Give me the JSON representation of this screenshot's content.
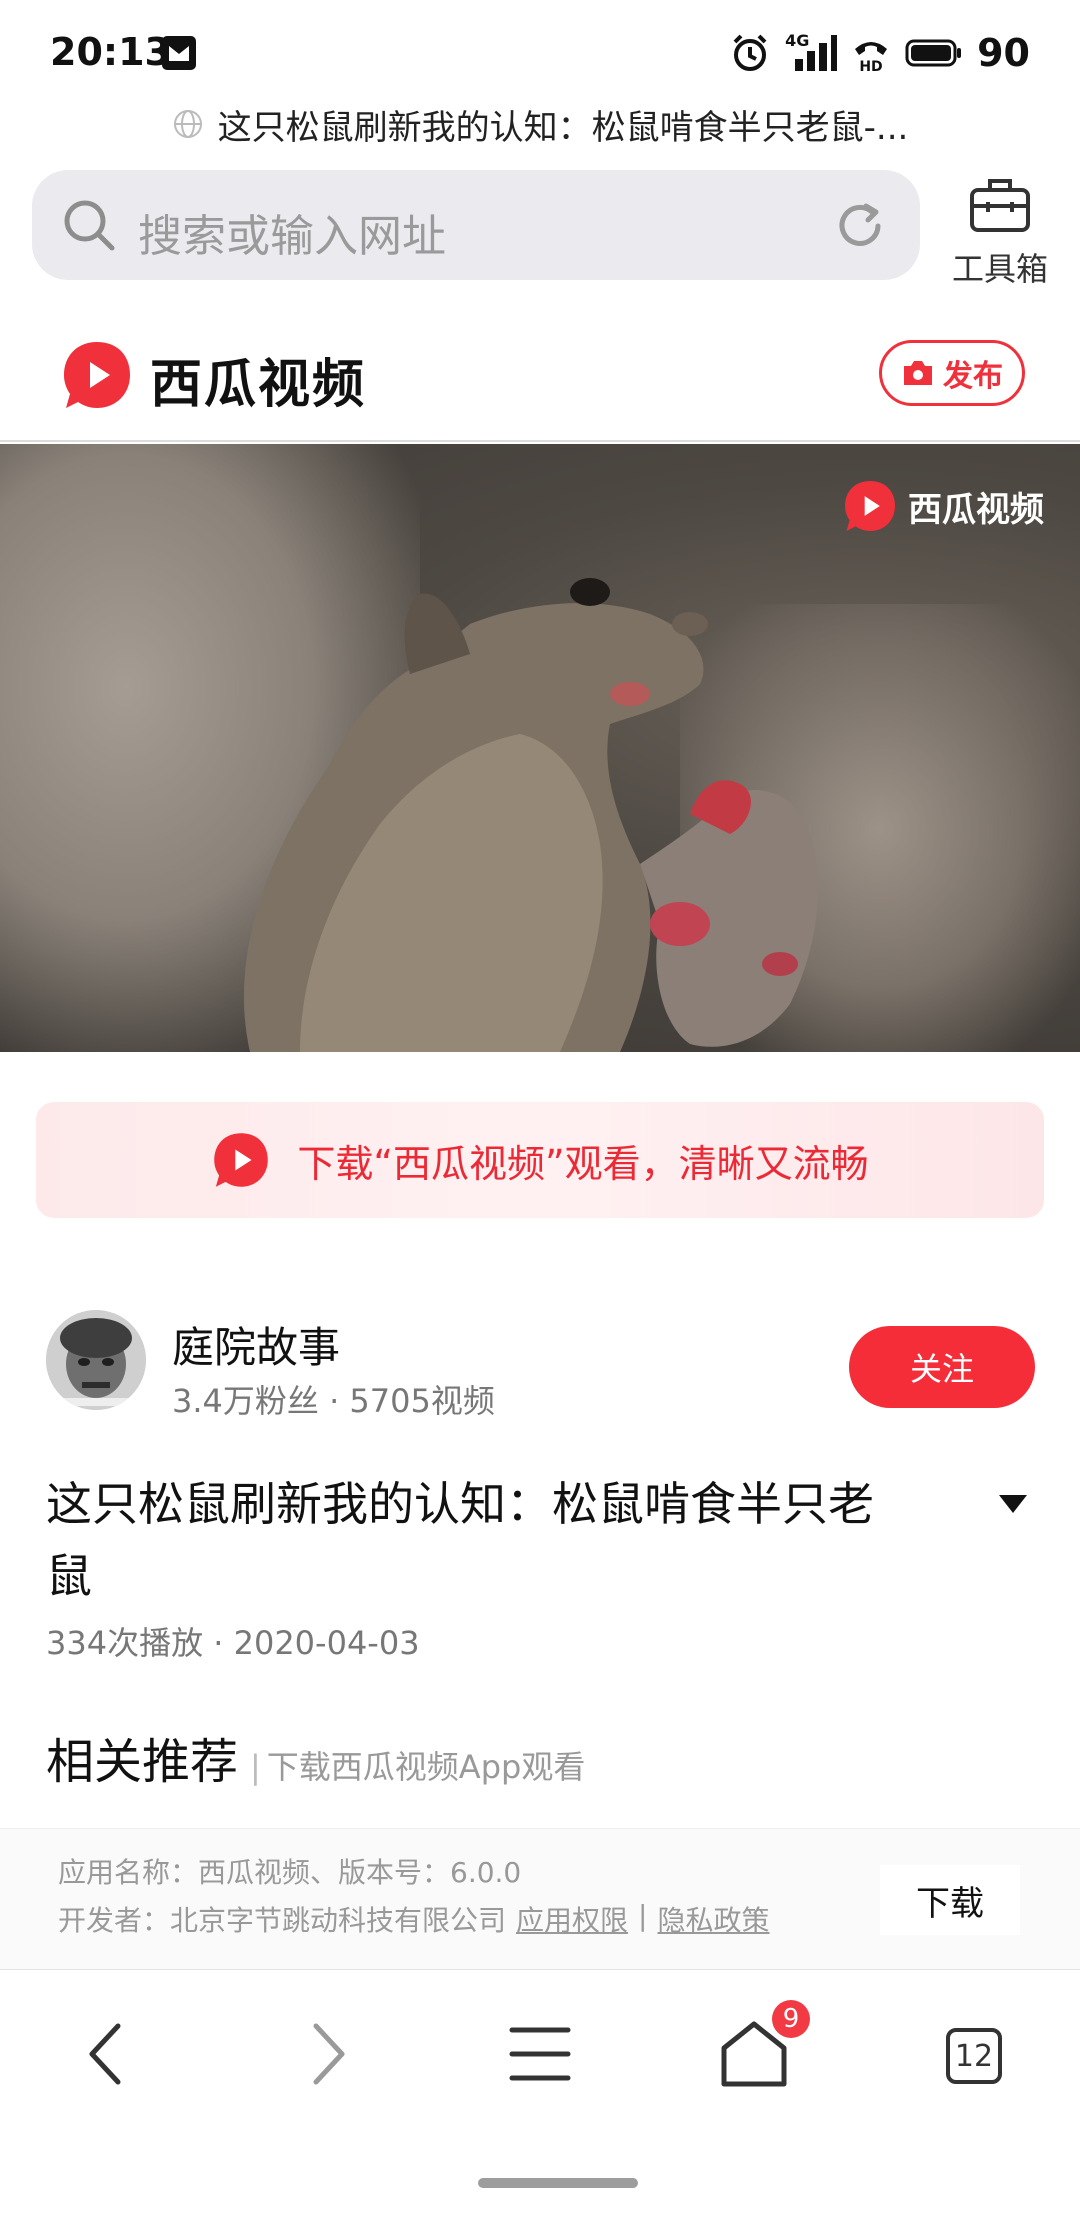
{
  "status_bar": {
    "time": "20:13",
    "network": "4G",
    "battery": "90"
  },
  "page_title": "这只松鼠刷新我的认知：松鼠啃食半只老鼠-...",
  "address_bar": {
    "placeholder": "搜索或输入网址"
  },
  "toolbox": {
    "label": "工具箱"
  },
  "site": {
    "brand": "西瓜视频",
    "publish_label": "发布",
    "brand_color": "#f0303a"
  },
  "video": {
    "watermark": "西瓜视频"
  },
  "download_banner": {
    "text": "下载“西瓜视频”观看，清晰又流畅"
  },
  "author": {
    "name": "庭院故事",
    "stats": "3.4万粉丝 · 5705视频",
    "follow_label": "关注"
  },
  "video_info": {
    "title": "这只松鼠刷新我的认知：松鼠啃食半只老鼠",
    "meta": "334次播放 · 2020-04-03"
  },
  "related": {
    "title": "相关推荐",
    "separator": "|",
    "hint": "下载西瓜视频App观看"
  },
  "app_info": {
    "line1": "应用名称：西瓜视频、版本号：6.0.0",
    "developer": "开发者：北京字节跳动科技有限公司",
    "permissions": "应用权限",
    "divider": "|",
    "privacy": "隐私政策",
    "download_label": "下载"
  },
  "bottom_nav": {
    "home_badge": "9",
    "tab_count": "12",
    "icons": [
      "back-icon",
      "forward-icon",
      "menu-icon",
      "home-icon",
      "tabs-icon"
    ]
  }
}
